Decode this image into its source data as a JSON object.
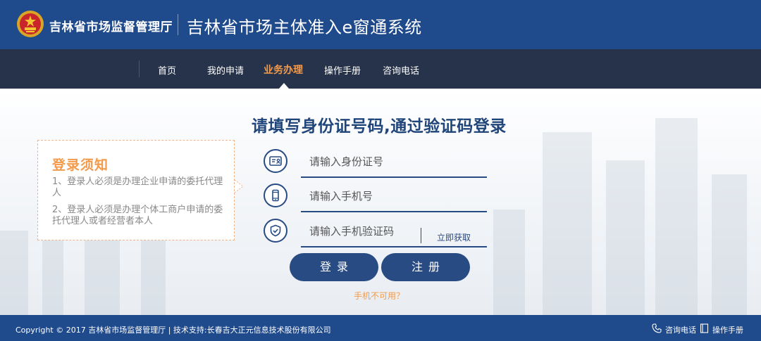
{
  "header": {
    "org_name": "吉林省市场监督管理厅",
    "system_title": "吉林省市场主体准入e窗通系统"
  },
  "nav": {
    "items": [
      {
        "label": "首页",
        "active": false
      },
      {
        "label": "我的申请",
        "active": false
      },
      {
        "label": "业务办理",
        "active": true
      },
      {
        "label": "操作手册",
        "active": false
      },
      {
        "label": "咨询电话",
        "active": false
      }
    ]
  },
  "notice": {
    "title": "登录须知",
    "line1": "1、登录人必须是办理企业申请的委托代理人",
    "line2": "2、登录人必须是办理个体工商户申请的委托代理人或者经营者本人"
  },
  "form": {
    "heading": "请填写身份证号码,通过验证码登录",
    "id_placeholder": "请输入身份证号",
    "phone_placeholder": "请输入手机号",
    "code_placeholder": "请输入手机验证码",
    "get_code_label": "立即获取",
    "login_label": "登录",
    "register_label": "注册",
    "phone_help": "手机不可用？"
  },
  "footer": {
    "copyright": "Copyright © 2017 吉林省市场监督管理厅 | 技术支持:长春吉大正元信息技术股份有限公司",
    "consult_label": "咨询电话",
    "manual_label": "操作手册"
  },
  "colors": {
    "header_bg": "#1f4a8c",
    "nav_bg": "#27334a",
    "accent_orange": "#f39a4b",
    "primary_blue": "#274b82"
  },
  "icons": [
    "national-emblem-icon",
    "id-card-icon",
    "mobile-phone-icon",
    "shield-check-icon",
    "phone-icon",
    "book-icon",
    "notice-arrow-icon"
  ]
}
